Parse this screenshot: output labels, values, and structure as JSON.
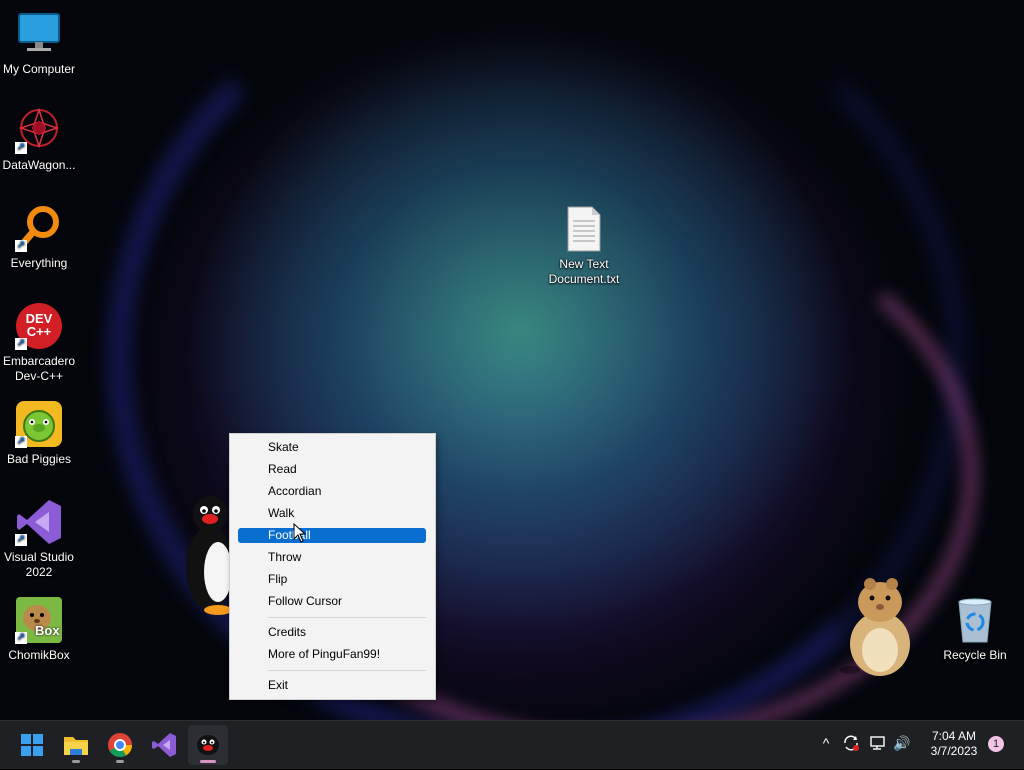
{
  "desktop_icons": [
    {
      "label": "My Computer",
      "icon": "monitor-icon",
      "shortcut": false
    },
    {
      "label": "DataWagon...",
      "icon": "datawagon-icon",
      "shortcut": true
    },
    {
      "label": "Everything",
      "icon": "everything-search-icon",
      "shortcut": true
    },
    {
      "label": "Embarcadero Dev-C++",
      "icon": "devcpp-icon",
      "shortcut": true
    },
    {
      "label": "Bad Piggies",
      "icon": "bad-piggies-icon",
      "shortcut": true
    },
    {
      "label": "Visual Studio 2022",
      "icon": "visual-studio-icon",
      "shortcut": true
    },
    {
      "label": "ChomikBox",
      "icon": "chomikbox-icon",
      "shortcut": true
    },
    {
      "label": "New Text Document.txt",
      "icon": "text-document-icon",
      "shortcut": false
    },
    {
      "label": "Recycle Bin",
      "icon": "recycle-bin-icon",
      "shortcut": false
    }
  ],
  "devcpp_glyph_text": "DEV C++",
  "chomikbox_glyph_text": "Box",
  "context_menu": {
    "items": [
      "Skate",
      "Read",
      "Accordian",
      "Walk",
      "Football",
      "Throw",
      "Flip",
      "Follow Cursor"
    ],
    "items2": [
      "Credits",
      "More of PinguFan99!"
    ],
    "items3": [
      "Exit"
    ],
    "selected": "Football"
  },
  "taskbar": {
    "apps": [
      "start-icon",
      "file-explorer-icon",
      "chrome-icon",
      "visual-studio-icon",
      "pingu-icon"
    ],
    "active_app": "pingu-icon"
  },
  "tray": {
    "time": "7:04 AM",
    "date": "3/7/2023",
    "notification_count": "1",
    "chevron": "^",
    "volume": "🔊"
  },
  "colors": {
    "accent": "#0a6ed1",
    "taskbar": "#1f2023"
  }
}
